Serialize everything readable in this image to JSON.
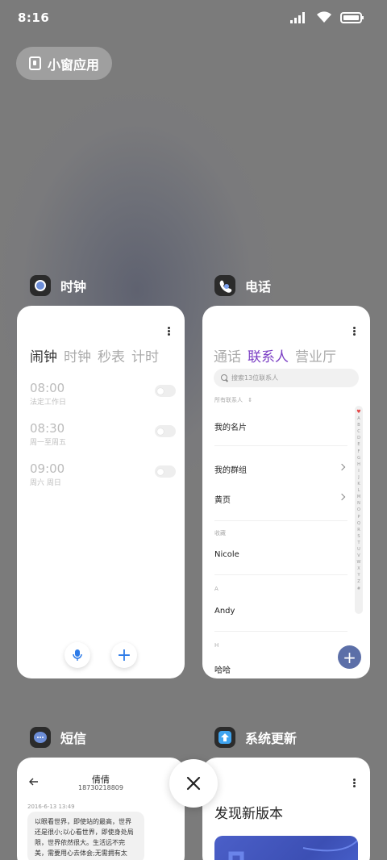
{
  "status_bar": {
    "time": "8:16"
  },
  "mini_window": {
    "label": "小窗应用"
  },
  "apps": {
    "clock": {
      "name": "时钟",
      "tabs": [
        "闹钟",
        "时钟",
        "秒表",
        "计时"
      ],
      "alarms": [
        {
          "time": "08:00",
          "label": "法定工作日"
        },
        {
          "time": "08:30",
          "label": "周一至周五"
        },
        {
          "time": "09:00",
          "label": "周六 周日"
        }
      ],
      "mic_icon": "microphone-icon",
      "add_icon": "+"
    },
    "phone": {
      "name": "电话",
      "tabs": [
        "通话",
        "联系人",
        "营业厅"
      ],
      "search_placeholder": "搜索13位联系人",
      "filter_label": "所有联系人",
      "my_card": "我的名片",
      "my_groups": "我的群组",
      "yellow_pages": "黄页",
      "favorites_header": "收藏",
      "favorite_contact": "Nicole",
      "section_a": "A",
      "contact_a": "Andy",
      "section_h": "H",
      "contact_h": "哈哈",
      "index_letters": [
        "A",
        "B",
        "C",
        "D",
        "E",
        "F",
        "G",
        "H",
        "I",
        "J",
        "K",
        "L",
        "M",
        "N",
        "O",
        "P",
        "Q",
        "R",
        "S",
        "T",
        "U",
        "V",
        "W",
        "X",
        "Y",
        "Z",
        "#"
      ],
      "accent_color": "#7b3fc4",
      "add_icon": "+"
    },
    "messages": {
      "name": "短信",
      "contact_name": "倩倩",
      "contact_number": "18730218809",
      "message_date": "2016-6-13 13:49",
      "message_text": "以眼看世界，即使站的最高，世界还是很小;以心看世界，即使身处局限，世界依然很大。生活远不完美，需要用心去体会;无需拥有太"
    },
    "system_update": {
      "name": "系统更新",
      "heading": "发现新版本"
    }
  },
  "close_button": {
    "icon": "close-icon"
  }
}
